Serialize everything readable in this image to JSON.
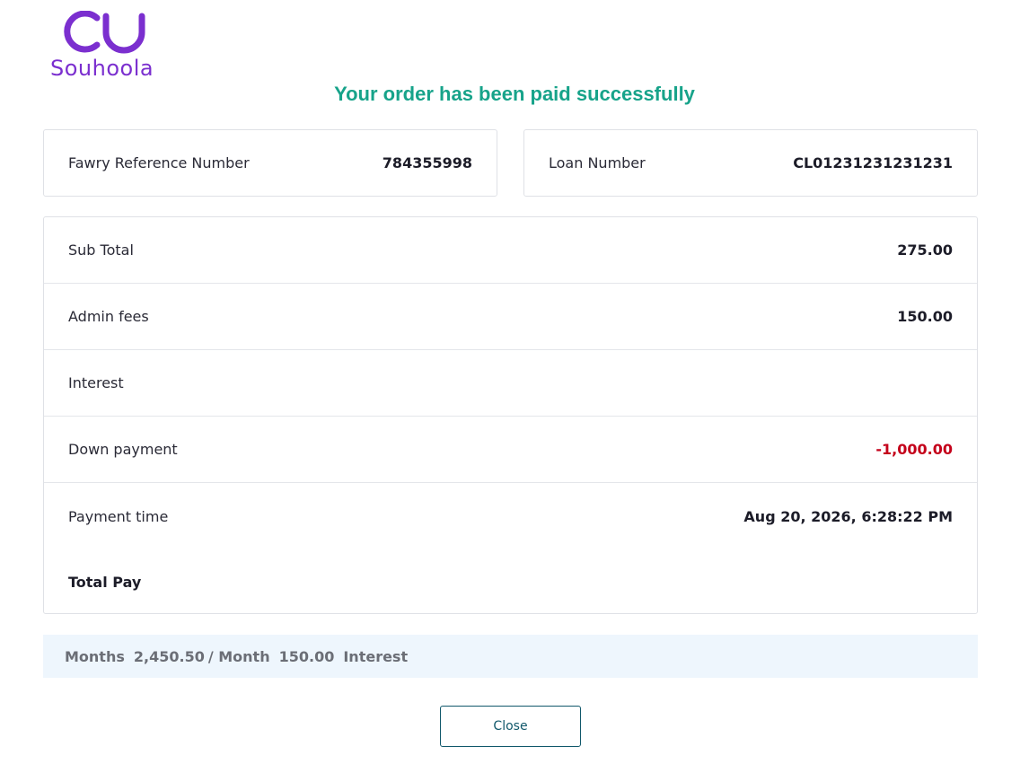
{
  "brand": {
    "name": "Souhoola",
    "color": "#7b2fcf"
  },
  "title": "Your order has been paid successfully",
  "reference": {
    "fawry_label": "Fawry Reference Number",
    "fawry_value": "784355998",
    "loan_label": "Loan Number",
    "loan_value": "CL01231231231231"
  },
  "details": [
    {
      "label": "Sub Total",
      "value": "275.00"
    },
    {
      "label": "Admin fees",
      "value": "150.00"
    },
    {
      "label": "Interest",
      "value": ""
    },
    {
      "label": "Down payment",
      "value": "-1,000.00"
    },
    {
      "label": "Payment time",
      "value": "Aug 20, 2026, 6:28:22 PM"
    }
  ],
  "total": {
    "label": "Total Pay",
    "value": ""
  },
  "months_bar": {
    "months_label": "Months",
    "per_month_value": "2,450.50",
    "per_month_label": "/ Month",
    "interest_value": "150.00",
    "interest_label": "Interest"
  },
  "close_label": "Close",
  "colors": {
    "success": "#17a38a",
    "negative": "#c4001a",
    "accent": "#11586b"
  }
}
